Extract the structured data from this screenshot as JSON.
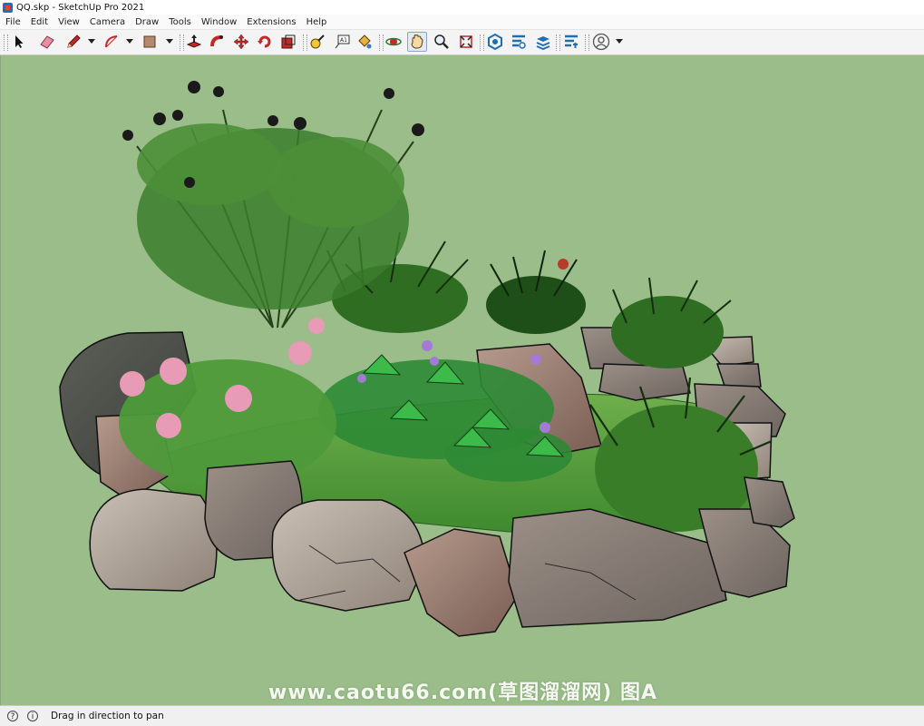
{
  "window": {
    "title": "QQ.skp - SketchUp Pro 2021"
  },
  "menu": [
    "File",
    "Edit",
    "View",
    "Camera",
    "Draw",
    "Tools",
    "Window",
    "Extensions",
    "Help"
  ],
  "toolbar": {
    "tools": [
      "select-icon",
      "eraser-icon",
      "pencil-icon",
      "arc-icon",
      "rectangle-icon",
      "push-pull-icon",
      "follow-me-icon",
      "move-icon",
      "rotate-icon",
      "scale-icon",
      "tape-measure-icon",
      "text-icon",
      "paint-bucket-icon",
      "orbit-icon",
      "pan-icon",
      "zoom-icon",
      "zoom-extents-icon",
      "3d-warehouse-icon",
      "extension-warehouse-icon",
      "layout-icon",
      "extension-manager-icon",
      "account-icon"
    ],
    "active_tool": "pan-icon",
    "colors": {
      "pencil": "#c22a2a",
      "accent_blue": "#1f6fb2"
    }
  },
  "viewport": {
    "background_color": "#9abd8a",
    "watermark": "www.caotu66.com(草图溜溜网) 图A"
  },
  "status": {
    "text": "Drag in direction to pan",
    "icons": [
      "geolocation-icon",
      "info-icon"
    ]
  }
}
